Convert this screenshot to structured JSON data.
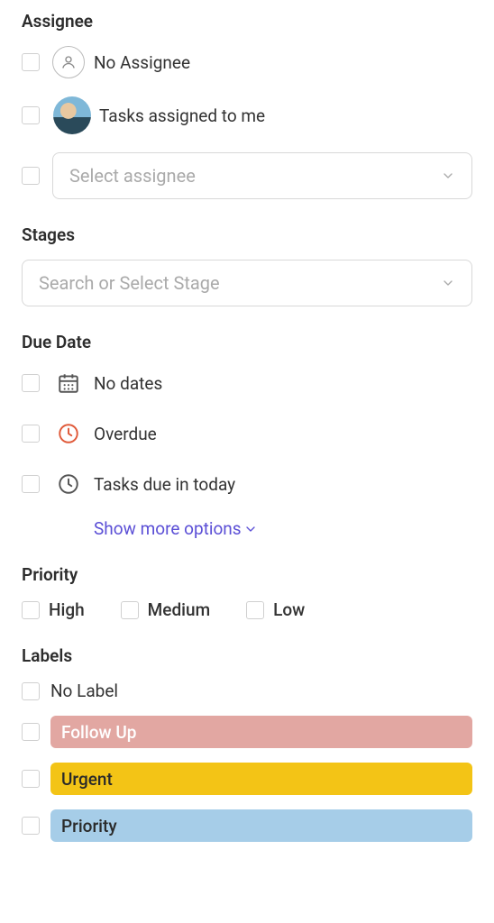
{
  "assignee": {
    "title": "Assignee",
    "no_assignee": "No Assignee",
    "tasks_to_me": "Tasks assigned to me",
    "select_placeholder": "Select assignee"
  },
  "stages": {
    "title": "Stages",
    "placeholder": "Search or Select Stage"
  },
  "due_date": {
    "title": "Due Date",
    "no_dates": "No dates",
    "overdue": "Overdue",
    "due_today": "Tasks due in today",
    "show_more": "Show more options"
  },
  "priority": {
    "title": "Priority",
    "high": "High",
    "medium": "Medium",
    "low": "Low"
  },
  "labels": {
    "title": "Labels",
    "no_label": "No Label",
    "items": {
      "follow_up": "Follow Up",
      "urgent": "Urgent",
      "priority": "Priority"
    }
  }
}
